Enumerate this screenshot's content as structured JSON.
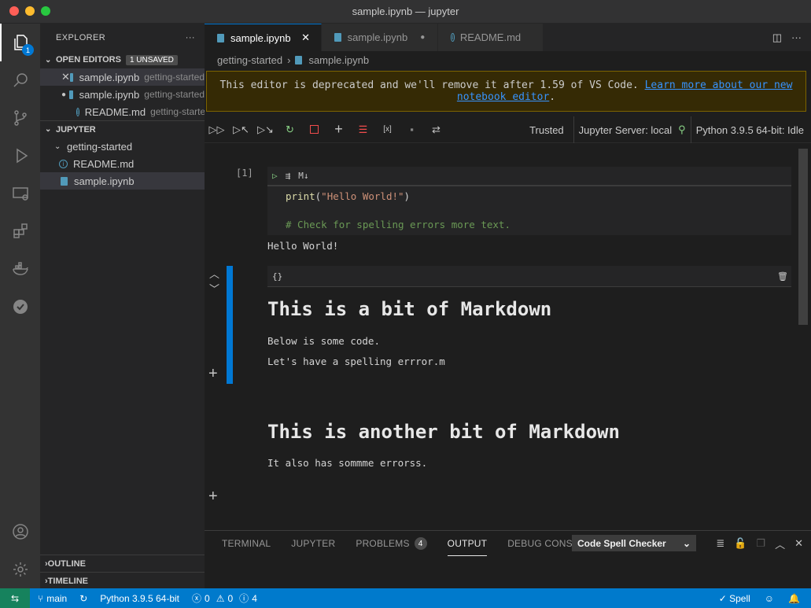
{
  "window": {
    "title": "sample.ipynb — jupyter"
  },
  "activity": {
    "explorer_badge": "1"
  },
  "sidebar": {
    "title": "EXPLORER",
    "more": "···",
    "open_editors": {
      "label": "OPEN EDITORS",
      "badge": "1 UNSAVED",
      "items": [
        {
          "mark": "✕",
          "name": "sample.ipynb",
          "desc": "getting-started"
        },
        {
          "mark": "●",
          "name": "sample.ipynb",
          "desc": "getting-started"
        },
        {
          "mark": "",
          "name": "README.md",
          "desc": "getting-started"
        }
      ]
    },
    "workspace": {
      "label": "JUPYTER",
      "folder": "getting-started",
      "files": [
        "README.md",
        "sample.ipynb"
      ]
    },
    "outline": "OUTLINE",
    "timeline": "TIMELINE"
  },
  "tabs": [
    {
      "label": "sample.ipynb",
      "state": "✕"
    },
    {
      "label": "sample.ipynb",
      "state": "●"
    },
    {
      "label": "README.md",
      "state": ""
    }
  ],
  "breadcrumb": {
    "folder": "getting-started",
    "file": "sample.ipynb"
  },
  "banner": {
    "text": "This editor is deprecated and we'll remove it after 1.59 of VS Code.",
    "link": "Learn more about our new notebook editor",
    "end": "."
  },
  "toolbar": {
    "trusted": "Trusted",
    "server": "Jupyter Server: local",
    "kernel": "Python 3.9.5 64-bit: Idle"
  },
  "notebook": {
    "code_cell": {
      "exec_count": "[1]",
      "lang_tag": "M↓",
      "fn": "print",
      "open": "(",
      "str": "\"Hello World!\"",
      "close": ")",
      "comment": "# Check for spelling errors more text.",
      "output": "Hello World!"
    },
    "md_cell": {
      "tag": "{}",
      "h1": "This is a bit of Markdown",
      "p1": "Below is some code.",
      "p2": "Let's have a spelling errror.m"
    },
    "md_cell_2": {
      "h1": "This is another bit of Markdown",
      "p1": "It also has sommme errorss."
    }
  },
  "panel": {
    "tabs": [
      "TERMINAL",
      "JUPYTER",
      "PROBLEMS",
      "OUTPUT",
      "DEBUG CONSOLE"
    ],
    "problems_count": "4",
    "output_channel": "Code Spell Checker"
  },
  "status": {
    "branch": "main",
    "interpreter": "Python 3.9.5 64-bit",
    "errors": "0",
    "warnings": "0",
    "infos": "4",
    "spell": "Spell"
  }
}
